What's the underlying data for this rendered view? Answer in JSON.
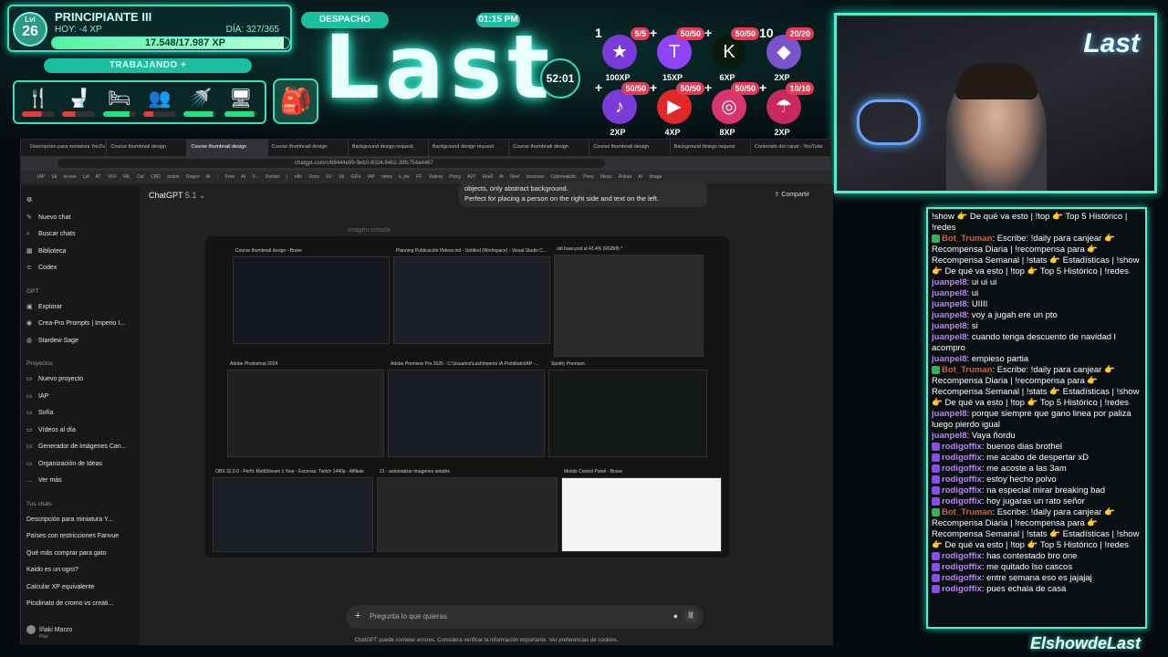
{
  "hud": {
    "level_label": "Lvl",
    "level": "26",
    "rank": "PRINCIPIANTE III",
    "today_xp": "HOY: -4 XP",
    "day": "DÍA: 327/365",
    "xp": "17.548/17.987 XP",
    "xp_fraction": 0.976,
    "status": "TRABAJANDO",
    "status_plus": "+",
    "needs": [
      {
        "icon": "utensils-icon",
        "glyph": "🍴",
        "level": 0.6,
        "color": "#e33a3a"
      },
      {
        "icon": "toilet-icon",
        "glyph": "🚽",
        "level": 0.4,
        "color": "#e33a3a"
      },
      {
        "icon": "bed-icon",
        "glyph": "🛏",
        "level": 0.8,
        "color": "#22e07a"
      },
      {
        "icon": "social-icon",
        "glyph": "👥",
        "level": 0.3,
        "color": "#e33a3a"
      },
      {
        "icon": "shower-icon",
        "glyph": "🚿",
        "level": 0.9,
        "color": "#22e07a"
      },
      {
        "icon": "fun-icon",
        "glyph": "🖥",
        "level": 0.9,
        "color": "#22e07a"
      }
    ],
    "despacho": "DESPACHO",
    "clock": "01:15 PM",
    "logo": "Last",
    "timer": "52:01",
    "achievements": [
      {
        "icon": "star-icon",
        "glyph": "★",
        "bg": "#7b3bd8",
        "count": "5/5",
        "level": "1",
        "xp": "100XP"
      },
      {
        "icon": "twitch-icon",
        "glyph": "T",
        "bg": "#8f44f7",
        "count": "50/50",
        "level": "",
        "xp": "15XP"
      },
      {
        "icon": "kick-icon",
        "glyph": "K",
        "bg": "#0a1a0c",
        "count": "50/50",
        "level": "",
        "xp": "6XP"
      },
      {
        "icon": "gem-icon",
        "glyph": "◆",
        "bg": "#7a52c9",
        "count": "20/20",
        "level": "10",
        "xp": "2XP"
      },
      {
        "icon": "tiktok-icon",
        "glyph": "♪",
        "bg": "#7b3bd8",
        "count": "50/50",
        "level": "",
        "xp": "2XP"
      },
      {
        "icon": "youtube-icon",
        "glyph": "▶",
        "bg": "#e02828",
        "count": "50/50",
        "level": "",
        "xp": "4XP"
      },
      {
        "icon": "instagram-icon",
        "glyph": "◎",
        "bg": "#d9346e",
        "count": "50/50",
        "level": "",
        "xp": "8XP"
      },
      {
        "icon": "parachute-icon",
        "glyph": "☂",
        "bg": "#c8285e",
        "count": "10/10",
        "level": "",
        "xp": "2XP"
      }
    ]
  },
  "cam": {
    "logo": "Last"
  },
  "browser": {
    "tabs": [
      "Descripción para miniatura YouTu",
      "Course thumbnail design",
      "Course thumbnail design",
      "Course thumbnail design",
      "Background design request",
      "Background design request",
      "Course thumbnail design",
      "Course thumbnail design",
      "Background design request",
      "Contenido del canal - YouTube"
    ],
    "url": "chatgpt.com/c/68444e99-9eb0-8024-94b2-38fc754a4467",
    "bookmarks": "IAP Sk to-use Lol AT VKF IRL Cal CRD action Dogen AI - Free AI V... Docker | n8n Docs SV Sk GIFs IAP minis k_inv FF Videos Proxy A2T Ebell AI Reel recursos Cyberealistic Pony Ideas Ruleta AI Image",
    "sidebar": {
      "top": [
        {
          "icon": "edit-icon",
          "glyph": "✎",
          "label": "Nuevo chat"
        },
        {
          "icon": "search-icon",
          "glyph": "⌕",
          "label": "Buscar chats"
        },
        {
          "icon": "library-icon",
          "glyph": "▦",
          "label": "Biblioteca"
        },
        {
          "icon": "codex-icon",
          "glyph": "⊂",
          "label": "Codex"
        }
      ],
      "gpt_heading": "GPT",
      "gpts": [
        {
          "icon": "explore-icon",
          "glyph": "▣",
          "label": "Explorar"
        },
        {
          "icon": "crea-pro-icon",
          "glyph": "◉",
          "label": "Crea-Pro Prompts | Imperio I..."
        },
        {
          "icon": "stardew-icon",
          "glyph": "◍",
          "label": "Stardew Sage"
        }
      ],
      "projects_heading": "Proyectos",
      "projects": [
        {
          "icon": "folder-plus-icon",
          "glyph": "▭",
          "label": "Nuevo proyecto"
        },
        {
          "icon": "folder-icon",
          "glyph": "▭",
          "label": "IAP"
        },
        {
          "icon": "folder-icon",
          "glyph": "▭",
          "label": "Sofía"
        },
        {
          "icon": "folder-icon",
          "glyph": "▭",
          "label": "Vídeos al día"
        },
        {
          "icon": "folder-icon",
          "glyph": "▭",
          "label": "Generador de Imágenes Can..."
        },
        {
          "icon": "folder-icon",
          "glyph": "▭",
          "label": "Organización de Ideas"
        },
        {
          "icon": "more-icon",
          "glyph": "…",
          "label": "Ver más"
        }
      ],
      "chats_heading": "Tus chats",
      "chats": [
        "Descripción para miniatura Y...",
        "Países con restricciones Fanvue",
        "Qué más comprar para gato",
        "Kaido es un ogro?",
        "Calcular XP equivalente",
        "Picolinato de cromo vs creati..."
      ],
      "user_name": "Iñaki Marzo",
      "user_plan": "Plus"
    },
    "title": "ChatGPT",
    "model": "5.1",
    "share": "Compartir",
    "bubble_line1": "objects, only abstract background.",
    "bubble_line2": "Perfect for placing a person on the right side and text on the left.",
    "image_caption": "Imagen creada",
    "windows": [
      {
        "title": "Course thumbnail design - Brave"
      },
      {
        "title": "Planning Publicación Videos.md - Untitled (Workspace) - Visual Studio C..."
      },
      {
        "title": "old base.psd al 43.4% (RGB/8) *"
      },
      {
        "title": "Adobe Photoshop 2024"
      },
      {
        "title": "Adobe Premiere Pro 2025 - C:\\Usuarios\\Last\\Imperio IA Prohibido\\IAP -..."
      },
      {
        "title": "Spotify Premium"
      },
      {
        "title": "OBS 32.0.0 - Perfil: MultiStream 1 Year - Escenas: Twitch 1440p - Affiliate"
      },
      {
        "title": "21 - automatizar imagenes airtable"
      },
      {
        "title": "Mobile Control Panel - Brave"
      }
    ],
    "input_placeholder": "Pregunta lo que quieras",
    "footer": "ChatGPT puede cometer errores. Considera verificar la información importante. Ver preferencias de cookies."
  },
  "chat": {
    "messages": [
      {
        "name": "",
        "color": "#ffffff",
        "badge": "",
        "text": "!show 👉 De qué va esto | !top 👉 Top 5 Histórico | !redes"
      },
      {
        "name": "Bot_Truman",
        "color": "#e05a2b",
        "badge": "#2fb84a",
        "text": ": Escribe: !daily para canjear 👉 Recompensa Diaria | !recompensa para 👉 Recompensa Semanal | !stats 👉 Estadísticas | !show 👉 De qué va esto | !top 👉 Top 5 Histórico | !redes"
      },
      {
        "name": "juanpel8",
        "color": "#c080ff",
        "badge": "",
        "text": ": ui ui ui"
      },
      {
        "name": "juanpel8",
        "color": "#c080ff",
        "badge": "",
        "text": ": ui"
      },
      {
        "name": "juanpel8",
        "color": "#c080ff",
        "badge": "",
        "text": ": UIIII"
      },
      {
        "name": "juanpel8",
        "color": "#c080ff",
        "badge": "",
        "text": ": voy a jugah ere un pto"
      },
      {
        "name": "juanpel8",
        "color": "#c080ff",
        "badge": "",
        "text": ": si"
      },
      {
        "name": "juanpel8",
        "color": "#c080ff",
        "badge": "",
        "text": ": cuando tenga descuento de navidad l acompro"
      },
      {
        "name": "juanpel8",
        "color": "#c080ff",
        "badge": "",
        "text": ": empieso partia"
      },
      {
        "name": "Bot_Truman",
        "color": "#e05a2b",
        "badge": "#2fb84a",
        "text": ": Escribe: !daily para canjear 👉 Recompensa Diaria | !recompensa para 👉 Recompensa Semanal | !stats 👉 Estadísticas | !show 👉 De qué va esto | !top 👉 Top 5 Histórico | !redes"
      },
      {
        "name": "juanpel8",
        "color": "#c080ff",
        "badge": "",
        "text": ": porque siempre que gano linea por paliza luego pierdo igual"
      },
      {
        "name": "juanpel8",
        "color": "#c080ff",
        "badge": "",
        "text": ": Vaya ñordu"
      },
      {
        "name": "rodigoffix",
        "color": "#c080ff",
        "badge": "#9146ff",
        "text": ": buenos dias brothel"
      },
      {
        "name": "rodigoffix",
        "color": "#c080ff",
        "badge": "#9146ff",
        "text": ": me acabo de despertar xD"
      },
      {
        "name": "rodigoffix",
        "color": "#c080ff",
        "badge": "#9146ff",
        "text": ": me acoste a las 3am"
      },
      {
        "name": "rodigoffix",
        "color": "#c080ff",
        "badge": "#9146ff",
        "text": ": estoy hecho polvo"
      },
      {
        "name": "rodigoffix",
        "color": "#c080ff",
        "badge": "#9146ff",
        "text": ": na especial mirar breaking bad"
      },
      {
        "name": "rodigoffix",
        "color": "#c080ff",
        "badge": "#9146ff",
        "text": ": hoy jugaras un rato señor"
      },
      {
        "name": "Bot_Truman",
        "color": "#e05a2b",
        "badge": "#2fb84a",
        "text": ": Escribe: !daily para canjear 👉 Recompensa Diaria | !recompensa para 👉 Recompensa Semanal | !stats 👉 Estadísticas | !show 👉 De qué va esto | !top 👉 Top 5 Histórico | !redes"
      },
      {
        "name": "rodigoffix",
        "color": "#c080ff",
        "badge": "#9146ff",
        "text": ": has contestado bro one"
      },
      {
        "name": "rodigoffix",
        "color": "#c080ff",
        "badge": "#9146ff",
        "text": ": me quitado lso cascos"
      },
      {
        "name": "rodigoffix",
        "color": "#c080ff",
        "badge": "#9146ff",
        "text": ": entre semana eso es jajajaj"
      },
      {
        "name": "rodigoffix",
        "color": "#c080ff",
        "badge": "#9146ff",
        "text": ": pues echala de casa"
      }
    ],
    "brand": "ElshowdeLast"
  }
}
